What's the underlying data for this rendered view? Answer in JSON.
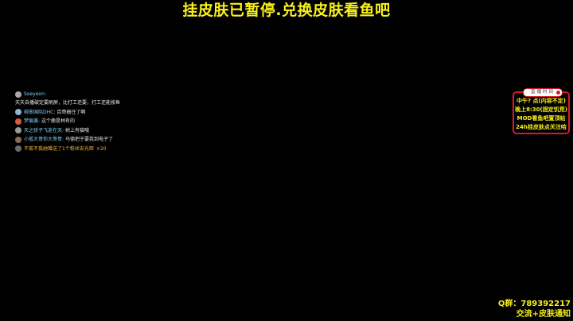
{
  "banner": {
    "text": "挂皮肤已暂停.兑换皮肤看鱼吧"
  },
  "chat": {
    "first": {
      "name": "Soeyeon:",
      "message": "天天自播破定要刷屏，比打工还要，打工还能按鱼"
    },
    "rows": [
      {
        "name": "柳笨国际DHC:",
        "message": "百哥搞住了啊",
        "gift": "",
        "avatar_color": "#8fb3d9"
      },
      {
        "name": "梦痕酱:",
        "message": "这个鹿是林有的",
        "gift": "",
        "avatar_color": "#e0533c"
      },
      {
        "name": "天之骄子飞逝在天:",
        "message": "树上有猫哦",
        "gift": "",
        "avatar_color": "#9a9a9a"
      },
      {
        "name": "小孤大哥你大哥哥:",
        "message": "马德把于要我到电子了",
        "gift": "",
        "avatar_color": "#8a6a55"
      },
      {
        "name": "",
        "message": "不孤不孤她赠送了1个粉丝安光辉",
        "gift": "×20",
        "avatar_color": "#6b6b6b"
      }
    ]
  },
  "schedule": {
    "header": "直播时间",
    "lines": [
      "中午? 点(内容不定)",
      "晚上8:30(固定饥荒)",
      "MOD看鱼吧置顶帖",
      "24h挂皮肤点关注哈"
    ]
  },
  "footer": {
    "qq": "Q群：789392217",
    "note": "交流+皮肤通知"
  },
  "colors": {
    "accent_yellow": "#f7f01a",
    "border_red": "#d9192b",
    "name_blue": "#7fd1f7"
  }
}
